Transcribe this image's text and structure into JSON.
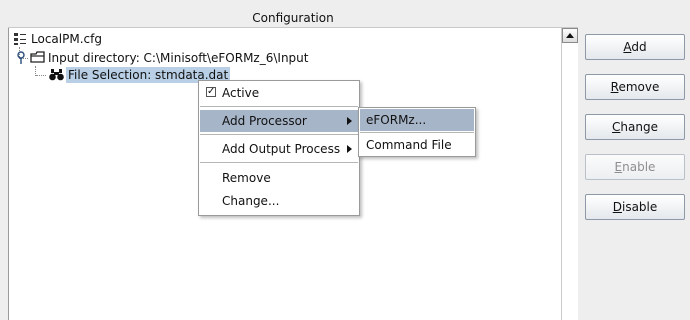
{
  "panel": {
    "title": "Configuration"
  },
  "tree": {
    "root": {
      "label": "LocalPM.cfg",
      "icon": "config-file-icon"
    },
    "input": {
      "label": "Input directory: C:\\Minisoft\\eFORMz_6\\Input",
      "icon": "folder-icon"
    },
    "file_selection": {
      "label": "File Selection: stmdata.dat",
      "icon": "binoculars-icon"
    }
  },
  "context_menu": {
    "active": "Active",
    "add_processor": "Add Processor",
    "add_output_process": "Add Output Process",
    "remove": "Remove",
    "change": "Change..."
  },
  "submenu": {
    "eformz": "eFORMz...",
    "command_file": "Command File"
  },
  "buttons": {
    "add": {
      "mnemonic": "A",
      "rest": "dd"
    },
    "remove": {
      "mnemonic": "R",
      "rest": "emove"
    },
    "change": {
      "mnemonic": "C",
      "rest": "hange"
    },
    "enable": {
      "mnemonic": "E",
      "rest": "nable"
    },
    "disable": {
      "mnemonic": "D",
      "rest": "isable"
    }
  },
  "colors": {
    "selection": "#b8cfe5",
    "menu_highlight": "#a7b5c9"
  }
}
